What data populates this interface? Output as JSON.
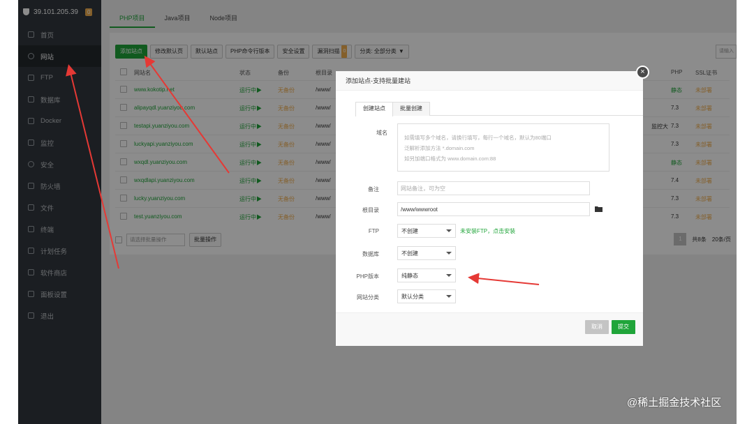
{
  "server": {
    "ip": "39.101.205.39",
    "alert_count": "0"
  },
  "sidebar": {
    "items": [
      {
        "label": "首页",
        "icon": "home-icon"
      },
      {
        "label": "网站",
        "icon": "globe-icon"
      },
      {
        "label": "FTP",
        "icon": "ftp-icon"
      },
      {
        "label": "数据库",
        "icon": "database-icon"
      },
      {
        "label": "Docker",
        "icon": "docker-icon"
      },
      {
        "label": "监控",
        "icon": "monitor-icon"
      },
      {
        "label": "安全",
        "icon": "shield-icon"
      },
      {
        "label": "防火墙",
        "icon": "firewall-icon"
      },
      {
        "label": "文件",
        "icon": "folder-icon"
      },
      {
        "label": "终端",
        "icon": "terminal-icon"
      },
      {
        "label": "计划任务",
        "icon": "calendar-icon"
      },
      {
        "label": "软件商店",
        "icon": "store-icon"
      },
      {
        "label": "面板设置",
        "icon": "gear-icon"
      },
      {
        "label": "退出",
        "icon": "logout-icon"
      }
    ]
  },
  "tabs": [
    "PHP项目",
    "Java项目",
    "Node项目"
  ],
  "toolbar": {
    "add_site": "添加站点",
    "edit_default_page": "修改默认页",
    "default_site": "默认站点",
    "php_cli": "PHP命令行版本",
    "security": "安全设置",
    "vuln_scan": "漏洞扫描",
    "vuln_count": "0",
    "category": "分类: 全部分类",
    "search_placeholder": "请输入"
  },
  "table": {
    "headers": {
      "name": "网站名",
      "status": "状态",
      "backup": "备份",
      "root": "根目录",
      "php": "PHP",
      "ssl": "SSL证书"
    },
    "rows": [
      {
        "name": "www.kokotip.net",
        "status": "运行中▶",
        "backup": "无备份",
        "root": "/www/",
        "php": "静态",
        "ssl": "未部署"
      },
      {
        "name": "alipayqdl.yuanziyou.com",
        "status": "运行中▶",
        "backup": "无备份",
        "root": "/www/",
        "php": "7.3",
        "ssl": "未部署"
      },
      {
        "name": "testapi.yuanziyou.com",
        "status": "运行中▶",
        "backup": "无备份",
        "root": "/www/",
        "php": "7.3",
        "ssl": "未部署"
      },
      {
        "name": "luckyapi.yuanziyou.com",
        "status": "运行中▶",
        "backup": "无备份",
        "root": "/www/",
        "php": "7.3",
        "ssl": "未部署"
      },
      {
        "name": "wxqdl.yuanziyou.com",
        "status": "运行中▶",
        "backup": "无备份",
        "root": "/www/",
        "php": "静态",
        "ssl": "未部署"
      },
      {
        "name": "wxqdlapi.yuanziyou.com",
        "status": "运行中▶",
        "backup": "无备份",
        "root": "/www/",
        "php": "7.4",
        "ssl": "未部署"
      },
      {
        "name": "lucky.yuanziyou.com",
        "status": "运行中▶",
        "backup": "无备份",
        "root": "/www/",
        "php": "7.3",
        "ssl": "未部署"
      },
      {
        "name": "test.yuanziyou.com",
        "status": "运行中▶",
        "backup": "无备份",
        "root": "/www/",
        "php": "7.3",
        "ssl": "未部署"
      }
    ],
    "row3_extra": "监控大",
    "batch_select": "请选择批量操作",
    "batch_button": "批量操作",
    "page": "1",
    "total": "共8条",
    "per_page": "20条/页"
  },
  "modal": {
    "title": "添加站点-支持批量建站",
    "tabs": [
      "创建站点",
      "批量创建"
    ],
    "domain_label": "域名",
    "domain_hint_1": "如需填写多个域名，请换行填写，每行一个域名，默认为80端口",
    "domain_hint_2": "泛解析添加方法 *.domain.com",
    "domain_hint_3": "如另加端口格式为 www.domain.com:88",
    "remark_label": "备注",
    "remark_placeholder": "网站备注，可为空",
    "root_label": "根目录",
    "root_value": "/www/wwwroot",
    "ftp_label": "FTP",
    "ftp_value": "不创建",
    "ftp_notice": "未安装FTP，点击安装",
    "db_label": "数据库",
    "db_value": "不创建",
    "php_label": "PHP版本",
    "php_value": "纯静态",
    "category_label": "网站分类",
    "category_value": "默认分类",
    "cancel": "取消",
    "submit": "提交"
  },
  "watermark": "@稀土掘金技术社区",
  "colors": {
    "accent": "#20a53a",
    "warning": "#f0ad4e",
    "arrow": "#e53935",
    "sidebar": "#32383f"
  }
}
